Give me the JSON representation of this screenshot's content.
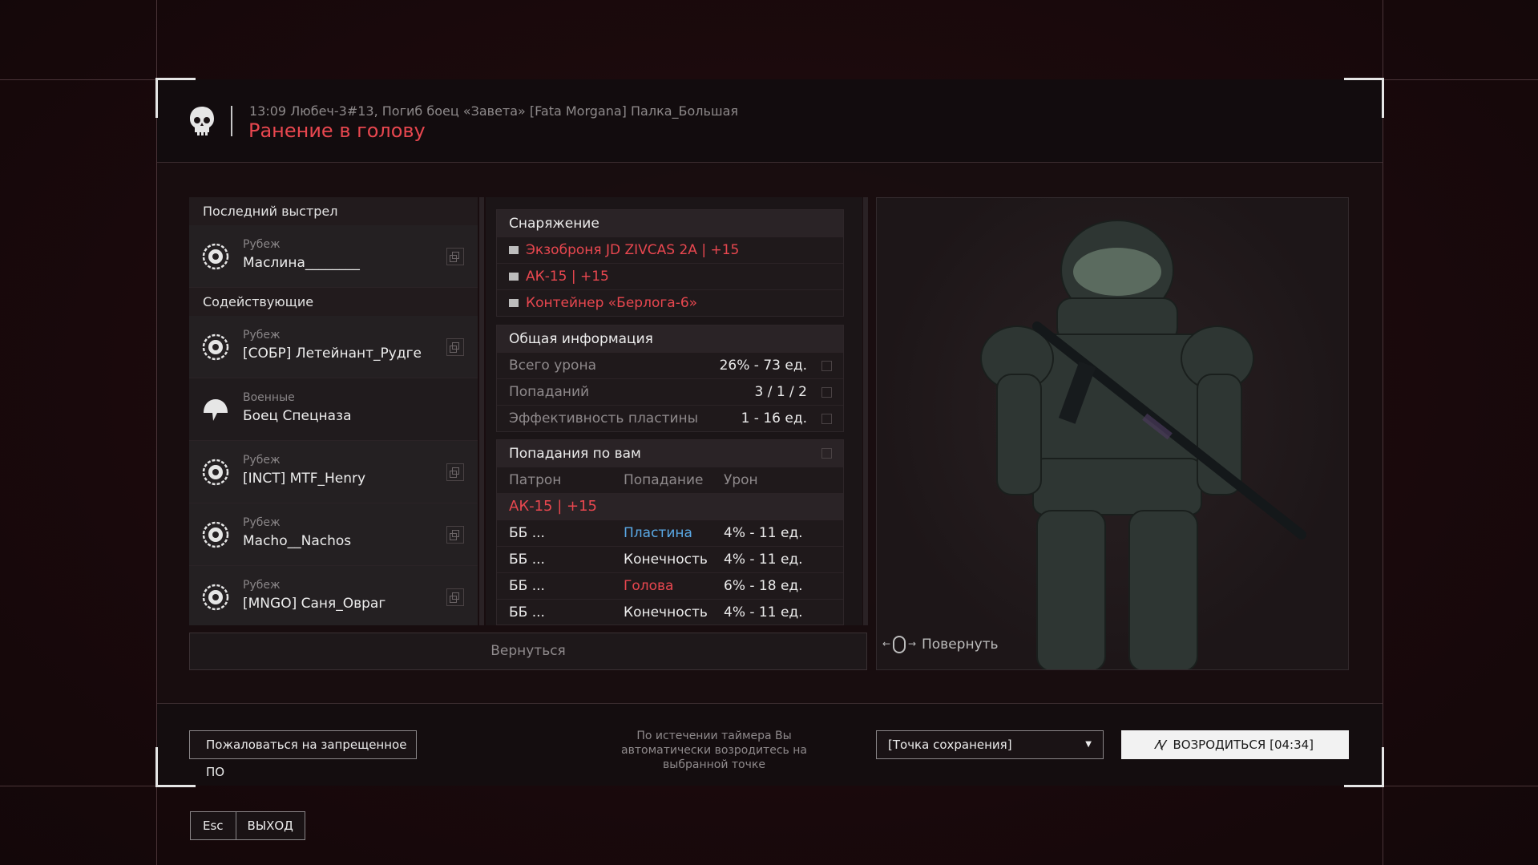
{
  "header": {
    "event": "13:09 Любеч-3#13, Погиб боец «Завета» [Fata Morgana] Палка_Большая",
    "cause": "Ранение в голову"
  },
  "killers": {
    "last_shot_title": "Последний выстрел",
    "last_shot": {
      "faction": "Рубеж",
      "name": "Маслина________"
    },
    "assists_title": "Содействующие",
    "assists": [
      {
        "faction": "Рубеж",
        "name": "[СОБР] Летейнант_Рудге"
      },
      {
        "faction": "Военные",
        "name": "Боец Спецназа"
      },
      {
        "faction": "Рубеж",
        "name": "[INCT] MTF_Henry"
      },
      {
        "faction": "Рубеж",
        "name": "Macho__Nachos"
      },
      {
        "faction": "Рубеж",
        "name": "[MNGO] Саня_Овраг"
      }
    ]
  },
  "equipment": {
    "title": "Снаряжение",
    "items": [
      "Экзоброня JD ZIVCAS 2A | +15",
      "АК-15 | +15",
      "Контейнер «Берлога-6»"
    ]
  },
  "general": {
    "title": "Общая информация",
    "rows": [
      {
        "label": "Всего урона",
        "value": "26% - 73 ед."
      },
      {
        "label": "Попаданий",
        "value": "3 / 1 / 2"
      },
      {
        "label": "Эффективность пластины",
        "value": "1 - 16 ед."
      }
    ]
  },
  "hits": {
    "title": "Попадания по вам",
    "columns": [
      "Патрон",
      "Попадание",
      "Урон"
    ],
    "weapon": "АК-15 | +15",
    "rows": [
      {
        "ammo": "ББ ...",
        "hit": "Пластина",
        "damage": "4% - 11 ед."
      },
      {
        "ammo": "ББ ...",
        "hit": "Конечность",
        "damage": "4% - 11 ед."
      },
      {
        "ammo": "ББ ...",
        "hit": "Голова",
        "damage": "6% - 18 ед."
      },
      {
        "ammo": "ББ ...",
        "hit": "Конечность",
        "damage": "4% - 11 ед."
      }
    ],
    "hit_colors": {
      "Пластина": "#5aa9e6",
      "Голова": "#e8474f",
      "Конечность": "#ececec"
    }
  },
  "preview": {
    "rotate_label": "Повернуть"
  },
  "back_label": "Вернуться",
  "footer": {
    "report_label": "Пожаловаться на запрещенное ПО",
    "timer_note": "По истечении таймера Вы автоматически возродитесь на выбранной точке",
    "spawn_point": "[Точка сохранения]",
    "respawn_label": "ВОЗРОДИТЬСЯ [04:34]"
  },
  "exit": {
    "key": "Esc",
    "label": "ВЫХОД"
  },
  "colors": {
    "accent_red": "#e8474f",
    "plate_blue": "#5aa9e6"
  }
}
